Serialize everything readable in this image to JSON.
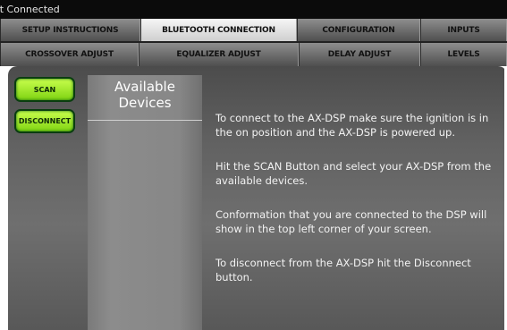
{
  "status": {
    "text": "ot Connected"
  },
  "tabs": {
    "row1": [
      {
        "label": "SETUP INSTRUCTIONS",
        "active": false
      },
      {
        "label": "BLUETOOTH CONNECTION",
        "active": true
      },
      {
        "label": "CONFIGURATION",
        "active": false
      },
      {
        "label": "INPUTS",
        "active": false
      }
    ],
    "row2": [
      {
        "label": "CROSSOVER ADJUST",
        "active": false
      },
      {
        "label": "EQUALIZER ADJUST",
        "active": false
      },
      {
        "label": "DELAY ADJUST",
        "active": false
      },
      {
        "label": "LEVELS",
        "active": false
      }
    ]
  },
  "buttons": {
    "scan_label": "SCAN",
    "disconnect_label": "DISCONNECT"
  },
  "devices": {
    "header_line1": "Available",
    "header_line2": "Devices"
  },
  "instructions": {
    "p1": "To connect to the AX-DSP make sure the ignition is in the on position and the AX-DSP is powered up.",
    "p2": "Hit the SCAN Button and select your AX-DSP from the available devices.",
    "p3": "Conformation that you are connected to the DSP will show in the top left corner of your screen.",
    "p4": "To disconnect from the AX-DSP hit the Disconnect button."
  },
  "colors": {
    "button_green": "#9be52a",
    "active_tab": "#e8e8e8",
    "tab": "#6e6e6e",
    "panel": "#636363"
  }
}
